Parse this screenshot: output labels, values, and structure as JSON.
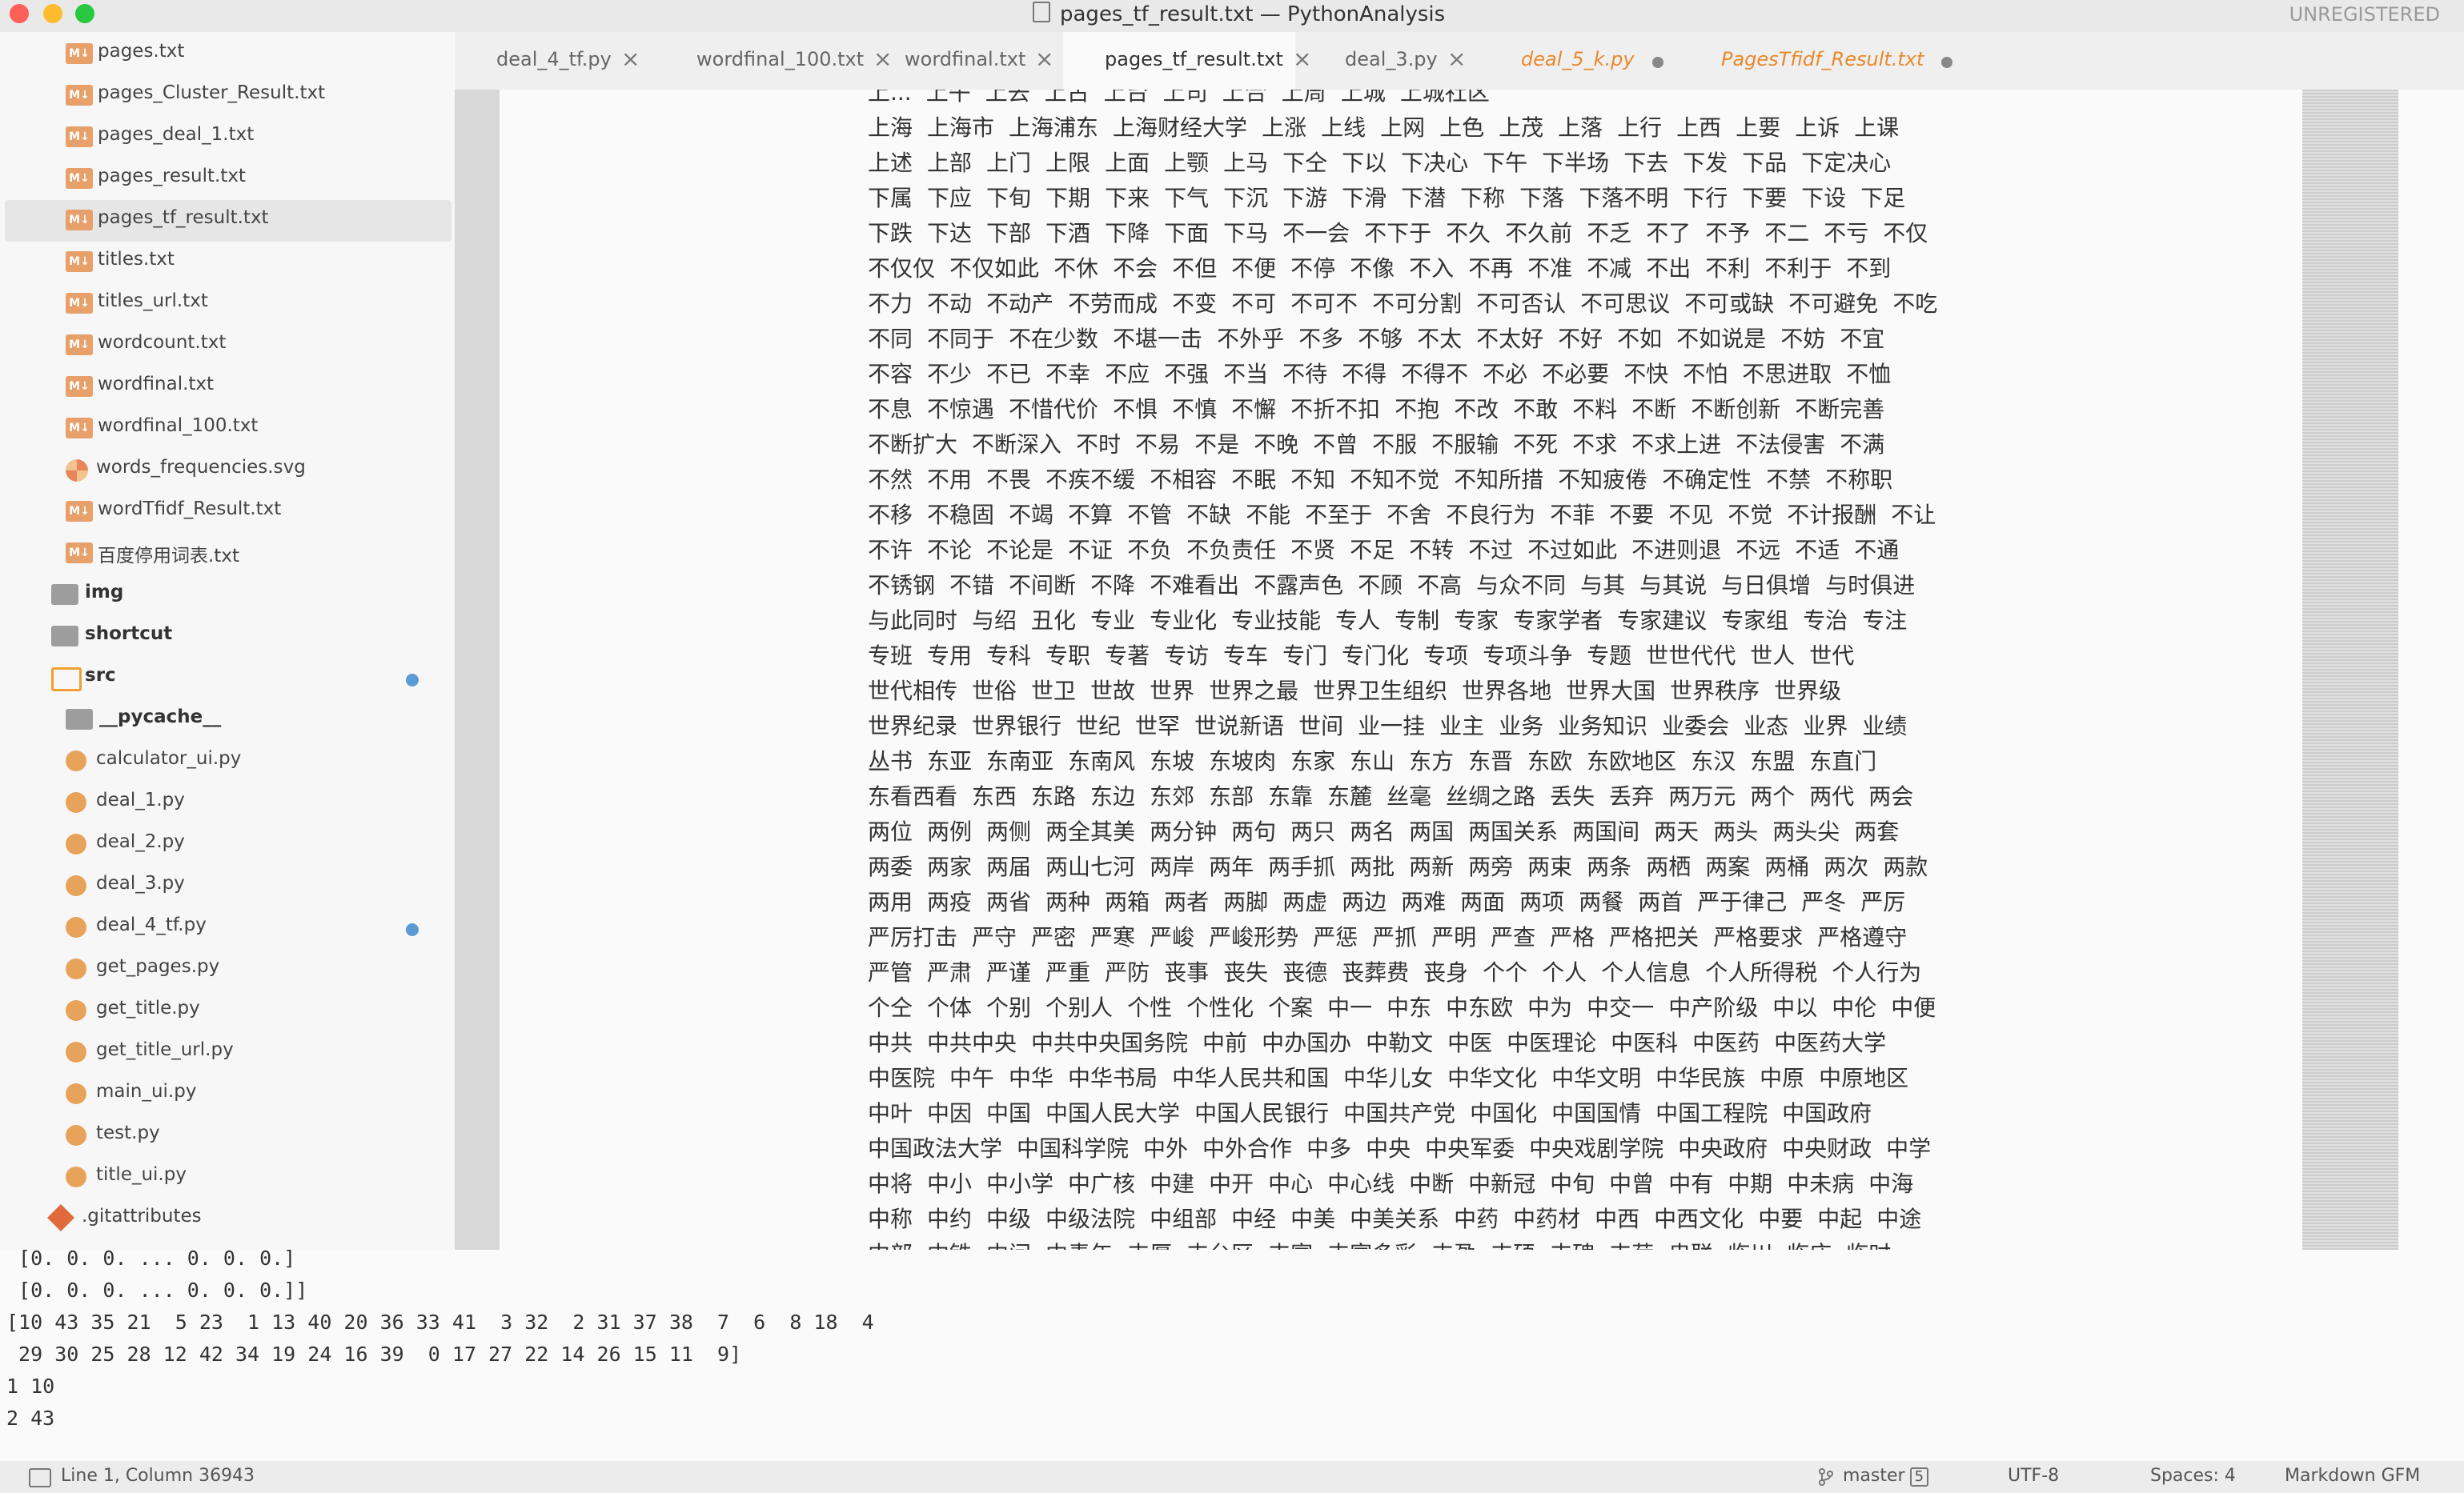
{
  "window": {
    "title": "pages_tf_result.txt — PythonAnalysis",
    "license": "UNREGISTERED"
  },
  "sidebar": {
    "items": [
      {
        "label": "pages.txt",
        "icon": "markdown-icon",
        "kind": "md",
        "indent": 1
      },
      {
        "label": "pages_Cluster_Result.txt",
        "icon": "markdown-icon",
        "kind": "md",
        "indent": 1
      },
      {
        "label": "pages_deal_1.txt",
        "icon": "markdown-icon",
        "kind": "md",
        "indent": 1
      },
      {
        "label": "pages_result.txt",
        "icon": "markdown-icon",
        "kind": "md",
        "indent": 1
      },
      {
        "label": "pages_tf_result.txt",
        "icon": "markdown-icon",
        "kind": "md",
        "indent": 1,
        "selected": true
      },
      {
        "label": "titles.txt",
        "icon": "markdown-icon",
        "kind": "md",
        "indent": 1
      },
      {
        "label": "titles_url.txt",
        "icon": "markdown-icon",
        "kind": "md",
        "indent": 1
      },
      {
        "label": "wordcount.txt",
        "icon": "markdown-icon",
        "kind": "md",
        "indent": 1
      },
      {
        "label": "wordfinal.txt",
        "icon": "markdown-icon",
        "kind": "md",
        "indent": 1
      },
      {
        "label": "wordfinal_100.txt",
        "icon": "markdown-icon",
        "kind": "md",
        "indent": 1
      },
      {
        "label": "words_frequencies.svg",
        "icon": "svg-file-icon",
        "kind": "svg",
        "indent": 1
      },
      {
        "label": "wordTfidf_Result.txt",
        "icon": "markdown-icon",
        "kind": "md",
        "indent": 1
      },
      {
        "label": "百度停用词表.txt",
        "icon": "markdown-icon",
        "kind": "md",
        "indent": 1
      },
      {
        "label": "img",
        "icon": "folder-icon",
        "kind": "folder",
        "indent": 0
      },
      {
        "label": "shortcut",
        "icon": "folder-icon",
        "kind": "folder",
        "indent": 0
      },
      {
        "label": "src",
        "icon": "folder-open-icon",
        "kind": "folder-open",
        "indent": 0,
        "modified": true
      },
      {
        "label": "__pycache__",
        "icon": "folder-icon",
        "kind": "folder",
        "indent": 1
      },
      {
        "label": "calculator_ui.py",
        "icon": "python-icon",
        "kind": "py",
        "indent": 1
      },
      {
        "label": "deal_1.py",
        "icon": "python-icon",
        "kind": "py",
        "indent": 1
      },
      {
        "label": "deal_2.py",
        "icon": "python-icon",
        "kind": "py",
        "indent": 1
      },
      {
        "label": "deal_3.py",
        "icon": "python-icon",
        "kind": "py",
        "indent": 1
      },
      {
        "label": "deal_4_tf.py",
        "icon": "python-icon",
        "kind": "py",
        "indent": 1,
        "modified": true
      },
      {
        "label": "get_pages.py",
        "icon": "python-icon",
        "kind": "py",
        "indent": 1
      },
      {
        "label": "get_title.py",
        "icon": "python-icon",
        "kind": "py",
        "indent": 1
      },
      {
        "label": "get_title_url.py",
        "icon": "python-icon",
        "kind": "py",
        "indent": 1
      },
      {
        "label": "main_ui.py",
        "icon": "python-icon",
        "kind": "py",
        "indent": 1
      },
      {
        "label": "test.py",
        "icon": "python-icon",
        "kind": "py",
        "indent": 1
      },
      {
        "label": "title_ui.py",
        "icon": "python-icon",
        "kind": "py",
        "indent": 1
      },
      {
        "label": ".gitattributes",
        "icon": "git-icon",
        "kind": "git",
        "indent": 0
      }
    ]
  },
  "tabs": [
    {
      "label": "deal_4_tf.py",
      "state": "close"
    },
    {
      "label": "wordfinal_100.txt",
      "state": "close"
    },
    {
      "label": "wordfinal.txt",
      "state": "close"
    },
    {
      "label": "pages_tf_result.txt",
      "state": "close",
      "active": true
    },
    {
      "label": "deal_3.py",
      "state": "close"
    },
    {
      "label": "deal_5_k.py",
      "state": "modified"
    },
    {
      "label": "PagesTfidf_Result.txt",
      "state": "modified"
    }
  ],
  "editor": {
    "lines": [
      [
        "上...",
        "上午",
        "上去",
        "上古",
        "上台",
        "上司",
        "上合",
        "上周",
        "上城",
        "上城社区"
      ],
      [
        "上海",
        "上海市",
        "上海浦东",
        "上海财经大学",
        "上涨",
        "上线",
        "上网",
        "上色",
        "上茂",
        "上落",
        "上行",
        "上西",
        "上要",
        "上诉",
        "上课"
      ],
      [
        "上述",
        "上部",
        "上门",
        "上限",
        "上面",
        "上颚",
        "上马",
        "下仝",
        "下以",
        "下决心",
        "下午",
        "下半场",
        "下去",
        "下发",
        "下品",
        "下定决心"
      ],
      [
        "下属",
        "下应",
        "下旬",
        "下期",
        "下来",
        "下气",
        "下沉",
        "下游",
        "下滑",
        "下潜",
        "下称",
        "下落",
        "下落不明",
        "下行",
        "下要",
        "下设",
        "下足"
      ],
      [
        "下跌",
        "下达",
        "下部",
        "下酒",
        "下降",
        "下面",
        "下马",
        "不一会",
        "不下于",
        "不久",
        "不久前",
        "不乏",
        "不了",
        "不予",
        "不二",
        "不亏",
        "不仅"
      ],
      [
        "不仅仅",
        "不仅如此",
        "不休",
        "不会",
        "不但",
        "不便",
        "不停",
        "不像",
        "不入",
        "不再",
        "不准",
        "不减",
        "不出",
        "不利",
        "不利于",
        "不到"
      ],
      [
        "不力",
        "不动",
        "不动产",
        "不劳而成",
        "不变",
        "不可",
        "不可不",
        "不可分割",
        "不可否认",
        "不可思议",
        "不可或缺",
        "不可避免",
        "不吃"
      ],
      [
        "不同",
        "不同于",
        "不在少数",
        "不堪一击",
        "不外乎",
        "不多",
        "不够",
        "不太",
        "不太好",
        "不好",
        "不如",
        "不如说是",
        "不妨",
        "不宜"
      ],
      [
        "不容",
        "不少",
        "不已",
        "不幸",
        "不应",
        "不强",
        "不当",
        "不待",
        "不得",
        "不得不",
        "不必",
        "不必要",
        "不快",
        "不怕",
        "不思进取",
        "不恤"
      ],
      [
        "不息",
        "不惊遇",
        "不惜代价",
        "不惧",
        "不慎",
        "不懈",
        "不折不扣",
        "不抱",
        "不改",
        "不敢",
        "不料",
        "不断",
        "不断创新",
        "不断完善"
      ],
      [
        "不断扩大",
        "不断深入",
        "不时",
        "不易",
        "不是",
        "不晚",
        "不曾",
        "不服",
        "不服输",
        "不死",
        "不求",
        "不求上进",
        "不法侵害",
        "不满"
      ],
      [
        "不然",
        "不用",
        "不畏",
        "不疾不缓",
        "不相容",
        "不眠",
        "不知",
        "不知不觉",
        "不知所措",
        "不知疲倦",
        "不确定性",
        "不禁",
        "不称职"
      ],
      [
        "不移",
        "不稳固",
        "不竭",
        "不算",
        "不管",
        "不缺",
        "不能",
        "不至于",
        "不舍",
        "不良行为",
        "不菲",
        "不要",
        "不见",
        "不觉",
        "不计报酬",
        "不让"
      ],
      [
        "不许",
        "不论",
        "不论是",
        "不证",
        "不负",
        "不负责任",
        "不贤",
        "不足",
        "不转",
        "不过",
        "不过如此",
        "不进则退",
        "不远",
        "不适",
        "不通"
      ],
      [
        "不锈钢",
        "不错",
        "不间断",
        "不降",
        "不难看出",
        "不露声色",
        "不顾",
        "不高",
        "与众不同",
        "与其",
        "与其说",
        "与日俱增",
        "与时俱进"
      ],
      [
        "与此同时",
        "与绍",
        "丑化",
        "专业",
        "专业化",
        "专业技能",
        "专人",
        "专制",
        "专家",
        "专家学者",
        "专家建议",
        "专家组",
        "专治",
        "专注"
      ],
      [
        "专班",
        "专用",
        "专科",
        "专职",
        "专著",
        "专访",
        "专车",
        "专门",
        "专门化",
        "专项",
        "专项斗争",
        "专题",
        "世世代代",
        "世人",
        "世代"
      ],
      [
        "世代相传",
        "世俗",
        "世卫",
        "世故",
        "世界",
        "世界之最",
        "世界卫生组织",
        "世界各地",
        "世界大国",
        "世界秩序",
        "世界级"
      ],
      [
        "世界纪录",
        "世界银行",
        "世纪",
        "世罕",
        "世说新语",
        "世间",
        "业一挂",
        "业主",
        "业务",
        "业务知识",
        "业委会",
        "业态",
        "业界",
        "业绩"
      ],
      [
        "丛书",
        "东亚",
        "东南亚",
        "东南风",
        "东坡",
        "东坡肉",
        "东家",
        "东山",
        "东方",
        "东晋",
        "东欧",
        "东欧地区",
        "东汉",
        "东盟",
        "东直门"
      ],
      [
        "东看西看",
        "东西",
        "东路",
        "东边",
        "东郊",
        "东部",
        "东靠",
        "东麓",
        "丝毫",
        "丝绸之路",
        "丢失",
        "丢弃",
        "两万元",
        "两个",
        "两代",
        "两会"
      ],
      [
        "两位",
        "两例",
        "两侧",
        "两全其美",
        "两分钟",
        "两句",
        "两只",
        "两名",
        "两国",
        "两国关系",
        "两国间",
        "两天",
        "两头",
        "两头尖",
        "两套"
      ],
      [
        "两委",
        "两家",
        "两届",
        "两山七河",
        "两岸",
        "两年",
        "两手抓",
        "两批",
        "两新",
        "两旁",
        "两束",
        "两条",
        "两栖",
        "两案",
        "两桶",
        "两次",
        "两款"
      ],
      [
        "两用",
        "两疫",
        "两省",
        "两种",
        "两箱",
        "两者",
        "两脚",
        "两虚",
        "两边",
        "两难",
        "两面",
        "两项",
        "两餐",
        "两首",
        "严于律己",
        "严冬",
        "严厉"
      ],
      [
        "严厉打击",
        "严守",
        "严密",
        "严寒",
        "严峻",
        "严峻形势",
        "严惩",
        "严抓",
        "严明",
        "严查",
        "严格",
        "严格把关",
        "严格要求",
        "严格遵守"
      ],
      [
        "严管",
        "严肃",
        "严谨",
        "严重",
        "严防",
        "丧事",
        "丧失",
        "丧德",
        "丧葬费",
        "丧身",
        "个个",
        "个人",
        "个人信息",
        "个人所得税",
        "个人行为"
      ],
      [
        "个仝",
        "个体",
        "个别",
        "个别人",
        "个性",
        "个性化",
        "个案",
        "中一",
        "中东",
        "中东欧",
        "中为",
        "中交一",
        "中产阶级",
        "中以",
        "中伦",
        "中便"
      ],
      [
        "中共",
        "中共中央",
        "中共中央国务院",
        "中前",
        "中办国办",
        "中勒文",
        "中医",
        "中医理论",
        "中医科",
        "中医药",
        "中医药大学"
      ],
      [
        "中医院",
        "中午",
        "中华",
        "中华书局",
        "中华人民共和国",
        "中华儿女",
        "中华文化",
        "中华文明",
        "中华民族",
        "中原",
        "中原地区"
      ],
      [
        "中叶",
        "中因",
        "中国",
        "中国人民大学",
        "中国人民银行",
        "中国共产党",
        "中国化",
        "中国国情",
        "中国工程院",
        "中国政府"
      ],
      [
        "中国政法大学",
        "中国科学院",
        "中外",
        "中外合作",
        "中多",
        "中央",
        "中央军委",
        "中央戏剧学院",
        "中央政府",
        "中央财政",
        "中学"
      ],
      [
        "中将",
        "中小",
        "中小学",
        "中广核",
        "中建",
        "中开",
        "中心",
        "中心线",
        "中断",
        "中新冠",
        "中旬",
        "中曾",
        "中有",
        "中期",
        "中未病",
        "中海"
      ],
      [
        "中称",
        "中约",
        "中级",
        "中级法院",
        "中组部",
        "中经",
        "中美",
        "中美关系",
        "中药",
        "中药材",
        "中西",
        "中西文化",
        "中要",
        "中起",
        "中途"
      ],
      [
        "中部",
        "中铁",
        "中间",
        "中青年",
        "丰厚",
        "丰台区",
        "丰富",
        "丰富多彩",
        "丰盈",
        "丰硕",
        "丰碑",
        "丰荷",
        "串联",
        "临川",
        "临床",
        "临时"
      ]
    ]
  },
  "console": {
    "lines": [
      " [0. 0. 0. ... 0. 0. 0.]",
      " [0. 0. 0. ... 0. 0. 0.]]",
      "[10 43 35 21  5 23  1 13 40 20 36 33 41  3 32  2 31 37 38  7  6  8 18  4",
      " 29 30 25 28 12 42 34 19 24 16 39  0 17 27 22 14 26 15 11  9]",
      "1 10",
      "2 43"
    ]
  },
  "status": {
    "position": "Line 1, Column 36943",
    "branch": "master",
    "branch_count": "5",
    "encoding": "UTF-8",
    "indent": "Spaces: 4",
    "syntax": "Markdown GFM"
  }
}
